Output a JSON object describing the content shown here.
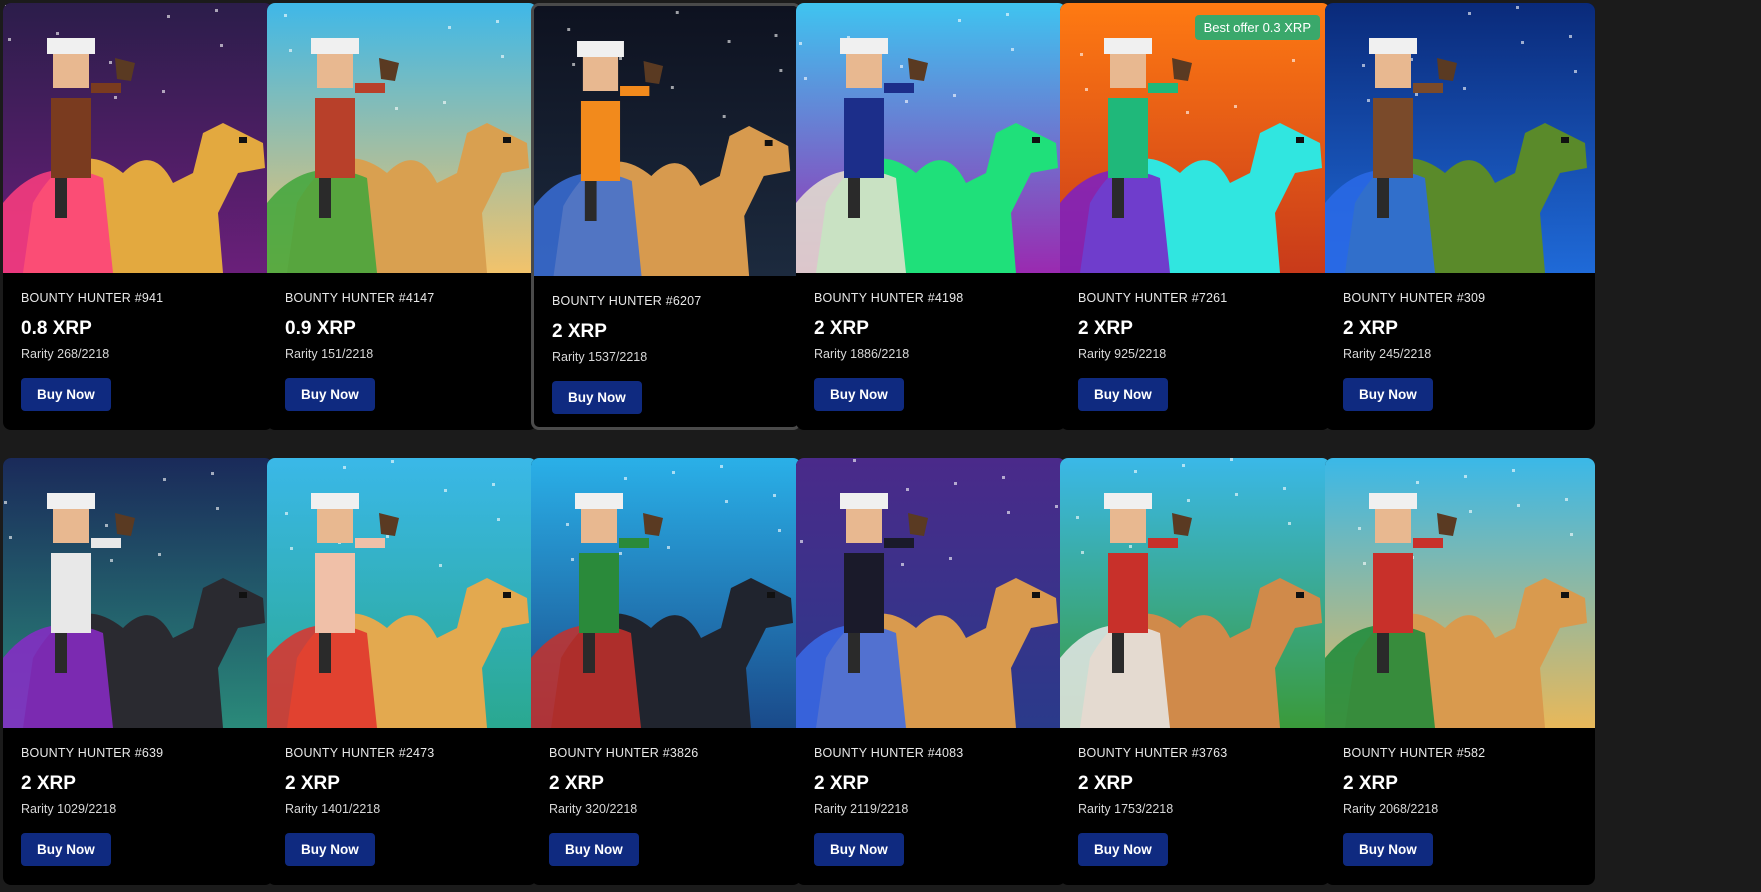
{
  "listings": [
    {
      "title": "BOUNTY HUNTER #941",
      "price": "0.8 XRP",
      "rarity": "Rarity 268/2218",
      "buy": "Buy Now",
      "bg_top": "#2b1d4a",
      "bg_bottom": "#6a1f7a",
      "camel": "#e3a93f",
      "rider": "#7a3b1f",
      "accent": "#ff3d7f"
    },
    {
      "title": "BOUNTY HUNTER #4147",
      "price": "0.9 XRP",
      "rarity": "Rarity 151/2218",
      "buy": "Buy Now",
      "bg_top": "#3fb8e8",
      "bg_bottom": "#f2c36b",
      "camel": "#d9a050",
      "rider": "#b8402a",
      "accent": "#3fa63b"
    },
    {
      "title": "BOUNTY HUNTER #6207",
      "price": "2 XRP",
      "rarity": "Rarity 1537/2218",
      "buy": "Buy Now",
      "bg_top": "#0e1220",
      "bg_bottom": "#1c2a3e",
      "camel": "#d79a4e",
      "rider": "#f28a1c",
      "accent": "#3a6fd8"
    },
    {
      "title": "BOUNTY HUNTER #4198",
      "price": "2 XRP",
      "rarity": "Rarity 1886/2218",
      "buy": "Buy Now",
      "bg_top": "#3fc4f0",
      "bg_bottom": "#9a2ab0",
      "camel": "#1fe07a",
      "rider": "#1c2e8a",
      "accent": "#e8e2d0"
    },
    {
      "title": "BOUNTY HUNTER #7261",
      "price": "2 XRP",
      "rarity": "Rarity 925/2218",
      "buy": "Buy Now",
      "badge": "Best offer 0.3 XRP",
      "bg_top": "#ff7a12",
      "bg_bottom": "#c83a1a",
      "camel": "#30e6e0",
      "rider": "#1fb87a",
      "accent": "#7a1ec8"
    },
    {
      "title": "BOUNTY HUNTER #309",
      "price": "2 XRP",
      "rarity": "Rarity 245/2218",
      "buy": "Buy Now",
      "bg_top": "#0a2a7a",
      "bg_bottom": "#1f6ad8",
      "camel": "#5a8a2a",
      "rider": "#7a4a2a",
      "accent": "#2a6ae8"
    },
    {
      "title": "BOUNTY HUNTER #639",
      "price": "2 XRP",
      "rarity": "Rarity 1029/2218",
      "buy": "Buy Now",
      "bg_top": "#1a2a5a",
      "bg_bottom": "#2a8a7a",
      "camel": "#2a2a30",
      "rider": "#e8e8e8",
      "accent": "#8a2ac8"
    },
    {
      "title": "BOUNTY HUNTER #2473",
      "price": "2 XRP",
      "rarity": "Rarity 1401/2218",
      "buy": "Buy Now",
      "bg_top": "#3ab8e8",
      "bg_bottom": "#2aa890",
      "camel": "#e3a94f",
      "rider": "#f0c0a8",
      "accent": "#e0302a"
    },
    {
      "title": "BOUNTY HUNTER #3826",
      "price": "2 XRP",
      "rarity": "Rarity 320/2218",
      "buy": "Buy Now",
      "bg_top": "#2ab0e8",
      "bg_bottom": "#1a4a8a",
      "camel": "#20242e",
      "rider": "#2a8a3a",
      "accent": "#c8302a"
    },
    {
      "title": "BOUNTY HUNTER #4083",
      "price": "2 XRP",
      "rarity": "Rarity 2119/2218",
      "buy": "Buy Now",
      "bg_top": "#4a2a8a",
      "bg_bottom": "#2a3a8a",
      "camel": "#d99a4e",
      "rider": "#1a1a2a",
      "accent": "#3a6ae8"
    },
    {
      "title": "BOUNTY HUNTER #3763",
      "price": "2 XRP",
      "rarity": "Rarity 1753/2218",
      "buy": "Buy Now",
      "bg_top": "#3ab8e8",
      "bg_bottom": "#3a9a3a",
      "camel": "#d08a4a",
      "rider": "#c8302a",
      "accent": "#e8e8e8"
    },
    {
      "title": "BOUNTY HUNTER #582",
      "price": "2 XRP",
      "rarity": "Rarity 2068/2218",
      "buy": "Buy Now",
      "bg_top": "#3ab8e8",
      "bg_bottom": "#e8b85a",
      "camel": "#d99a4e",
      "rider": "#c8302a",
      "accent": "#1a8a3a"
    }
  ]
}
